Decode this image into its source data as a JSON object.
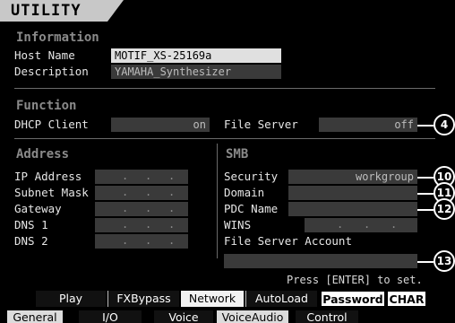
{
  "title": "UTILITY",
  "information": {
    "heading": "Information",
    "host_name_label": "Host Name",
    "host_name_value": "MOTIF_XS-25169a",
    "description_label": "Description",
    "description_value": "YAMAHA_Synthesizer"
  },
  "function": {
    "heading": "Function",
    "dhcp_label": "DHCP Client",
    "dhcp_value": "on",
    "file_server_label": "File Server",
    "file_server_value": "off"
  },
  "address": {
    "heading": "Address",
    "ip_label": "IP Address",
    "subnet_label": "Subnet Mask",
    "gateway_label": "Gateway",
    "dns1_label": "DNS 1",
    "dns2_label": "DNS 2",
    "dot": "."
  },
  "smb": {
    "heading": "SMB",
    "security_label": "Security",
    "security_value": "workgroup",
    "domain_label": "Domain",
    "domain_value": "",
    "pdc_label": "PDC Name",
    "pdc_value": "",
    "wins_label": "WINS",
    "account_label": "File Server Account",
    "account_value": "",
    "hint": "Press [ENTER] to set."
  },
  "callouts": [
    "4",
    "10",
    "11",
    "12",
    "13"
  ],
  "tabs_upper": [
    "Play",
    "FXBypass",
    "Network",
    "AutoLoad",
    "Password",
    "CHAR"
  ],
  "tabs_lower": [
    "General",
    "I/O",
    "Voice",
    "VoiceAudio",
    "Control"
  ],
  "colors": {
    "screen_bg": "#000000",
    "field_bg": "#3a3a3a",
    "selected_field_bg": "#e0e0e0",
    "section_heading": "#8a8a8a"
  }
}
